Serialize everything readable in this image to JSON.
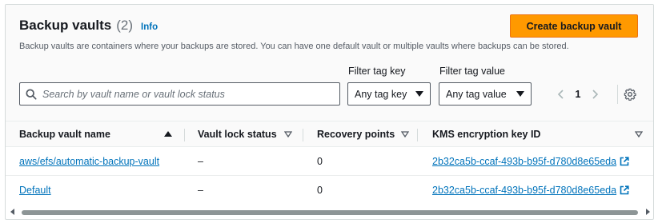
{
  "header": {
    "title": "Backup vaults",
    "count": "(2)",
    "info_label": "Info",
    "description": "Backup vaults are containers where your backups are stored. You can have one default vault or multiple vaults where backups can be stored.",
    "create_button_label": "Create backup vault"
  },
  "search": {
    "placeholder": "Search by vault name or vault lock status",
    "value": ""
  },
  "filters": {
    "tag_key_label": "Filter tag key",
    "tag_key_value": "Any tag key",
    "tag_value_label": "Filter tag value",
    "tag_value_value": "Any tag value"
  },
  "pagination": {
    "current_page": "1"
  },
  "table": {
    "columns": [
      {
        "label": "Backup vault name",
        "sort": "ascending"
      },
      {
        "label": "Vault lock status",
        "sort": "none"
      },
      {
        "label": "Recovery points",
        "sort": "none"
      },
      {
        "label": "KMS encryption key ID",
        "sort": "none"
      }
    ],
    "rows": [
      {
        "name": "aws/efs/automatic-backup-vault",
        "lock_status": "–",
        "recovery_points": "0",
        "kms_key": "2b32ca5b-ccaf-493b-b95f-d780d8e65eda"
      },
      {
        "name": "Default",
        "lock_status": "–",
        "recovery_points": "0",
        "kms_key": "2b32ca5b-ccaf-493b-b95f-d780d8e65eda"
      }
    ]
  },
  "icons": {
    "search": "search-icon",
    "caret": "caret-down-icon",
    "prev": "chevron-left-icon",
    "next": "chevron-right-icon",
    "settings": "gear-icon",
    "external": "external-link-icon"
  },
  "colors": {
    "primary_button": "#ff9900",
    "link": "#0073bb",
    "text": "#16191f",
    "muted": "#545b64"
  }
}
